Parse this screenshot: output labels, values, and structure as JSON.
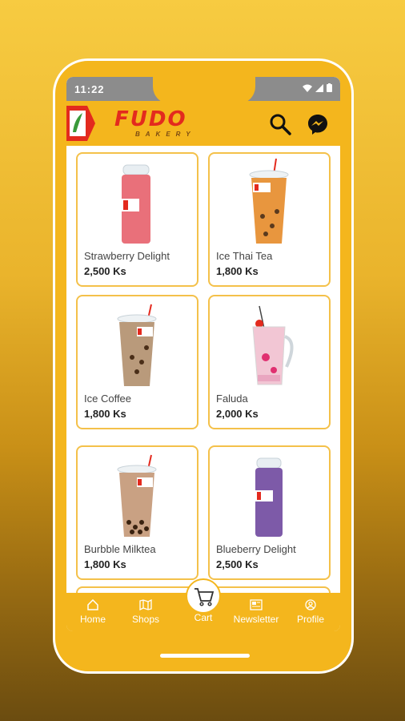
{
  "status_bar": {
    "time": "11:22"
  },
  "header": {
    "brand_name": "FUDO",
    "brand_sub": "BAKERY",
    "accent_color": "#f4b61d",
    "brand_color": "#e32a1e"
  },
  "products": [
    {
      "name": "Strawberry Delight",
      "price": "2,500 Ks",
      "drink_color": "#e9707a"
    },
    {
      "name": "Ice Thai Tea",
      "price": "1,800 Ks",
      "drink_color": "#e8963e"
    },
    {
      "name": "Ice Coffee",
      "price": "1,800 Ks",
      "drink_color": "#b99a7b"
    },
    {
      "name": "Faluda",
      "price": "2,000 Ks",
      "drink_color": "#f2c6d4"
    },
    {
      "name": "Burbble Milktea",
      "price": "1,800 Ks",
      "drink_color": "#c9a183"
    },
    {
      "name": "Blueberry Delight",
      "price": "2,500 Ks",
      "drink_color": "#7d5aa8"
    }
  ],
  "bottom_nav": {
    "home": "Home",
    "shops": "Shops",
    "cart": "Cart",
    "newsletter": "Newsletter",
    "profile": "Profile"
  }
}
